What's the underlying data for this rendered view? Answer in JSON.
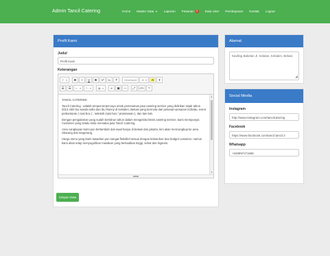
{
  "navbar": {
    "brand": "Admin Tancil Catering",
    "items": [
      {
        "label": "Home",
        "caret": false,
        "badge": ""
      },
      {
        "label": "Master Data",
        "caret": true,
        "badge": ""
      },
      {
        "label": "Laporan",
        "caret": false,
        "badge": ""
      },
      {
        "label": "Pesanan",
        "caret": false,
        "badge": "8"
      },
      {
        "label": "Data User",
        "caret": false,
        "badge": ""
      },
      {
        "label": "Pembayaran",
        "caret": false,
        "badge": ""
      },
      {
        "label": "Kontak",
        "caret": false,
        "badge": ""
      },
      {
        "label": "Logout",
        "caret": false,
        "badge": ""
      }
    ]
  },
  "profil": {
    "title": "Profil Kami",
    "judul_label": "Judul",
    "judul_value": "Profil Kami",
    "keterangan_label": "Keterangan",
    "toolbar": {
      "style_glyph": "✐",
      "bold": "B",
      "italic": "I",
      "underline": "U",
      "strike": "S",
      "superscript": "x²",
      "subscript": "x₂",
      "eraser": "⚘",
      "font_family": "Helvetica",
      "font_size": "10",
      "color": "A",
      "ul": "☰",
      "ol": "☰",
      "para": "≡",
      "height": "T↕",
      "table": "▦",
      "link": "∞",
      "picture": "▣",
      "hr": "―",
      "fullscreen": "⤢",
      "code": "</>",
      "help": "?"
    },
    "content": [
      "TANCIL CATERING",
      "Tancil Catering : adalah tempat terpercaya untuk pemesanan jasa catering service yang didirikan sejak tahun 2013 oleh ibu wanda sofia dan ibu Ranny di Kebalen, Bekasi yang bermula dari pesanan-pesanan individu, event perkantoran ( nasi box ) , sekolah (nasi box / prasmanan ), dan lain lain.",
      "Dengan pengalaman yang sudah bertahun tahun dalam mengelola bisnis catering service, kami mempunyai Customer yang selalu setia memakai jasa Tancil Catering.",
      "Area cangkupan kami pun bertambah dari awal hanya di bekasi dan jakarta, kini akan mencangkup ke area cikarang dan tangerang.",
      "Harga menu yang kami tawarkan pun sangat fleksibel sesuai dengan kebutuhan dan budget customer, namun kami akan tetap menyuguhkan masakan yang berkualitas tinggi, sehat dan higienis."
    ],
    "save_label": "Simpan Data"
  },
  "alamat": {
    "title": "Alamat",
    "value": "Kaviling Babelan Jl. Selatan, Kebalen, Bekasi"
  },
  "sosmed": {
    "title": "Social Media",
    "instagram_label": "Instagram",
    "instagram_value": "http://www.instagram.com/tancilcatering",
    "facebook_label": "Facebook",
    "facebook_value": "https://www.facebook.com/tancil.tancil.3",
    "whatsapp_label": "Whatsapp",
    "whatsapp_value": "+628997471686"
  },
  "colors": {
    "navbar": "#4caf50",
    "panel_header": "#3a7bc8",
    "button": "#4caf50",
    "badge": "#e53935",
    "background": "#ececec"
  }
}
